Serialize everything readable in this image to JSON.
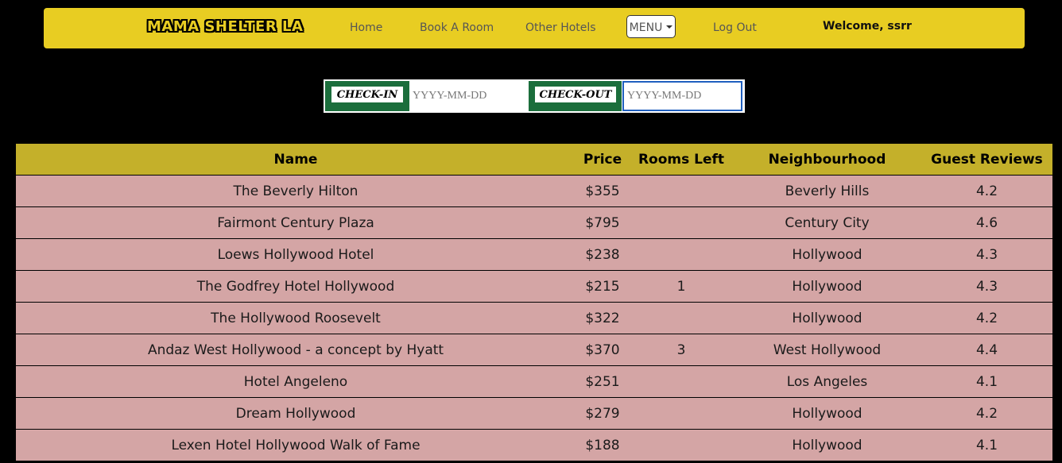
{
  "navbar": {
    "brand": "MAMA SHELTER LA",
    "links": [
      "Home",
      "Book A Room",
      "Other Hotels"
    ],
    "menu_label": "MENU",
    "logout": "Log Out",
    "welcome": "Welcome, ssrr"
  },
  "dates": {
    "checkin_label": "CHECK-IN",
    "checkin_placeholder": "YYYY-MM-DD",
    "checkout_label": "CHECK-OUT",
    "checkout_placeholder": "YYYY-MM-DD"
  },
  "table": {
    "headers": [
      "Name",
      "Price",
      "Rooms Left",
      "Neighbourhood",
      "Guest Reviews"
    ],
    "rows": [
      {
        "name": "The Beverly Hilton",
        "price": "$355",
        "rooms": "",
        "hood": "Beverly Hills",
        "rating": "4.2"
      },
      {
        "name": "Fairmont Century Plaza",
        "price": "$795",
        "rooms": "",
        "hood": "Century City",
        "rating": "4.6"
      },
      {
        "name": "Loews Hollywood Hotel",
        "price": "$238",
        "rooms": "",
        "hood": "Hollywood",
        "rating": "4.3"
      },
      {
        "name": "The Godfrey Hotel Hollywood",
        "price": "$215",
        "rooms": "1",
        "hood": "Hollywood",
        "rating": "4.3"
      },
      {
        "name": "The Hollywood Roosevelt",
        "price": "$322",
        "rooms": "",
        "hood": "Hollywood",
        "rating": "4.2"
      },
      {
        "name": "Andaz West Hollywood - a concept by Hyatt",
        "price": "$370",
        "rooms": "3",
        "hood": "West Hollywood",
        "rating": "4.4"
      },
      {
        "name": "Hotel Angeleno",
        "price": "$251",
        "rooms": "",
        "hood": "Los Angeles",
        "rating": "4.1"
      },
      {
        "name": "Dream Hollywood",
        "price": "$279",
        "rooms": "",
        "hood": "Hollywood",
        "rating": "4.2"
      },
      {
        "name": "Lexen Hotel Hollywood Walk of Fame",
        "price": "$188",
        "rooms": "",
        "hood": "Hollywood",
        "rating": "4.1"
      }
    ]
  }
}
